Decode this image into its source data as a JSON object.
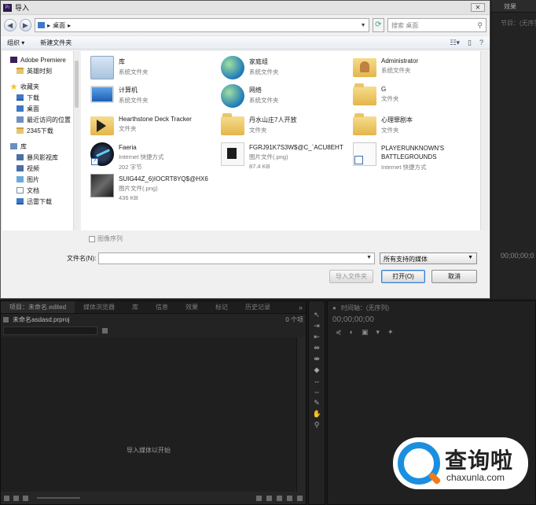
{
  "premiere": {
    "effects_tab": "效果",
    "node_label": "节目：(无序列)",
    "right_timecode": "00;00;00;0",
    "project_tabs": [
      "项目：未命名.edited",
      "媒体浏览器",
      "库",
      "信息",
      "效果",
      "标记",
      "历史记录"
    ],
    "tabs_more": "»",
    "project_file": "未命名asdasd.prproj",
    "item_count": "0 个项",
    "empty_hint": "导入媒体以开始",
    "timeline_title": "时间轴：(无序列)",
    "timeline_timecode": "00;00;00;00"
  },
  "watermark": {
    "title": "查询啦",
    "subtitle": "chaxunla.com"
  },
  "dialog": {
    "title": "导入",
    "close_glyph": "✕",
    "address": "桌面",
    "address_arrow": "▸",
    "search_placeholder": "搜索 桌面",
    "organize": "组织 ▾",
    "new_folder": "新建文件夹",
    "nav": {
      "head_items": [
        "Adobe Premiere",
        "收藏夹"
      ],
      "adobe_sub": [
        "英雄时刻"
      ],
      "fav_sub": [
        "下载",
        "桌面",
        "最近访问的位置",
        "2345下载"
      ],
      "lib_head": "库",
      "lib_sub": [
        "暴风影视库",
        "视频",
        "图片",
        "文档",
        "迅雷下载"
      ]
    },
    "files": [
      {
        "name": "库",
        "sub1": "系统文件夹",
        "sub2": "",
        "icon": "library-icon"
      },
      {
        "name": "家庭组",
        "sub1": "系统文件夹",
        "sub2": "",
        "icon": "homegroup-icon"
      },
      {
        "name": "Administrator",
        "sub1": "系统文件夹",
        "sub2": "",
        "icon": "user-folder-icon"
      },
      {
        "name": "计算机",
        "sub1": "系统文件夹",
        "sub2": "",
        "icon": "computer-icon"
      },
      {
        "name": "网络",
        "sub1": "系统文件夹",
        "sub2": "",
        "icon": "network-icon"
      },
      {
        "name": "G",
        "sub1": "文件夹",
        "sub2": "",
        "icon": "folder-icon"
      },
      {
        "name": "Hearthstone Deck Tracker",
        "sub1": "文件夹",
        "sub2": "",
        "icon": "folder-icon"
      },
      {
        "name": "丹水山庄7人开放",
        "sub1": "文件夹",
        "sub2": "",
        "icon": "folder-icon"
      },
      {
        "name": "心理罪剧本",
        "sub1": "文件夹",
        "sub2": "",
        "icon": "folder-icon"
      },
      {
        "name": "Faeria",
        "sub1": "Internet 快捷方式",
        "sub2": "202 字节",
        "icon": "faeria-icon"
      },
      {
        "name": "FGRJ91K7S3W$@C_`ACU8EHT",
        "sub1": "图片文件(.png)",
        "sub2": "87.4 KB",
        "icon": "image-icon"
      },
      {
        "name": "PLAYERUNKNOWN'S BATTLEGROUNDS",
        "sub1": "Internet 快捷方式",
        "sub2": "",
        "icon": "shortcut-icon"
      },
      {
        "name": "SUIG44Z_6)IOCRT8YQ$@HX6",
        "sub1": "图片文件(.png)",
        "sub2": "436 KB",
        "icon": "image-icon"
      }
    ],
    "image_sequence": "图像序列",
    "filename_label": "文件名(N):",
    "filename_value": "",
    "file_type": "所有支持的媒体",
    "btn_import_folder": "导入文件夹",
    "btn_open": "打开(O)",
    "btn_cancel": "取消"
  }
}
